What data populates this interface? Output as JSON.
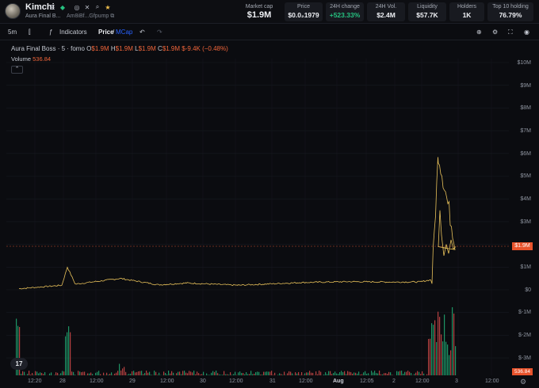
{
  "token": {
    "name": "Kimchi",
    "subtitle": "Aura Final B...",
    "address": "Am8iBf...Gfpump"
  },
  "stats": [
    {
      "label": "Market cap",
      "value": "$1.9M"
    },
    {
      "label": "Price",
      "value": "$0.0₂1979"
    },
    {
      "label": "24H change",
      "value": "+523.33%"
    },
    {
      "label": "24H Vol.",
      "value": "$2.4M"
    },
    {
      "label": "Liquidity",
      "value": "$57.7K"
    },
    {
      "label": "Holders",
      "value": "1K"
    },
    {
      "label": "Top 10 holding",
      "value": "76.79%"
    }
  ],
  "toolbar": {
    "interval": "5m",
    "indicators": "Indicators",
    "price_label": "Price",
    "separator": "/",
    "mcap_label": "MCap"
  },
  "legend": {
    "title": "Aura Final Boss · 5 · fomo",
    "o_label": "O",
    "o_value": "$1.9M",
    "h_label": "H",
    "h_value": "$1.9M",
    "l_label": "L",
    "l_value": "$1.9M",
    "c_label": "C",
    "c_value": "$1.9M",
    "change": "$-9.4K (−0.48%)",
    "volume_label": "Volume",
    "volume_value": "536.84"
  },
  "y_axis": [
    "$10M",
    "$9M",
    "$8M",
    "$7M",
    "$6M",
    "$5M",
    "$4M",
    "$3M",
    "$1M",
    "$0",
    "$-1M",
    "$-2M",
    "$-3M"
  ],
  "price_tag": "$1.9M",
  "volume_tag": "536.84",
  "x_axis": [
    "12:20",
    "28",
    "12:00",
    "29",
    "12:00",
    "30",
    "12:00",
    "31",
    "12:00",
    "Aug",
    "12:05",
    "2",
    "12:00",
    "3",
    "12:00"
  ],
  "colors": {
    "up": "#26c281",
    "down": "#ef5350",
    "line": "#e8c15a",
    "accent": "#2962ff",
    "tag": "#e8532c"
  },
  "chart_data": {
    "type": "line",
    "title": "Aura Final Boss · 5 · fomo",
    "xlabel": "",
    "ylabel": "",
    "ylim": [
      -3000000,
      10000000
    ],
    "grid": true,
    "legend": "top-left",
    "x": [
      "12:20",
      "28",
      "12:00",
      "29",
      "12:00",
      "30",
      "12:00",
      "31",
      "12:00",
      "Aug",
      "12:05",
      "2",
      "12:00",
      "12:00 (2)",
      "3"
    ],
    "series": [
      {
        "values": [
          50000,
          200000,
          1000000,
          250000,
          500000,
          220000,
          300000,
          200000,
          320000,
          360000,
          340000,
          350000,
          450000,
          6000000,
          1900000
        ]
      }
    ]
  }
}
